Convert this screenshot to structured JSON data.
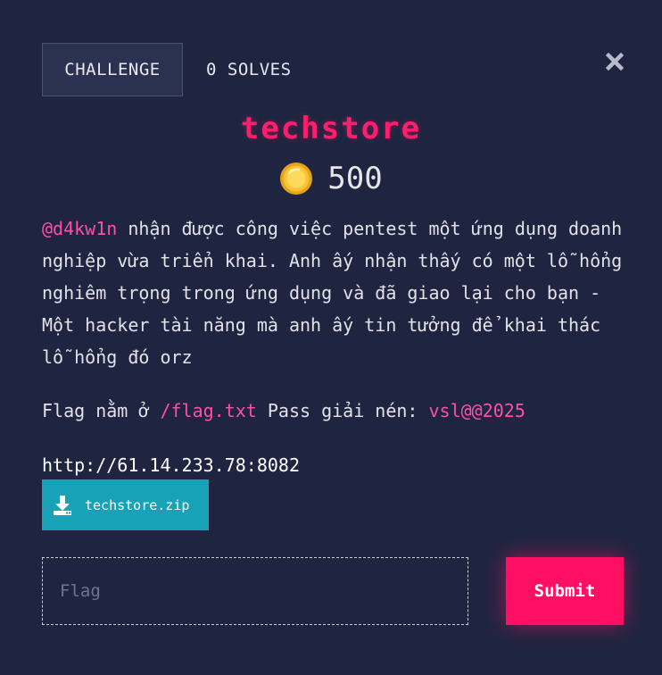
{
  "tabs": {
    "challenge_label": "CHALLENGE",
    "solves_label": "0 SOLVES"
  },
  "challenge": {
    "title": "techstore",
    "points": "500",
    "description": {
      "author": "@d4kw1n",
      "text": " nhận được công việc pentest một ứng dụng doanh nghiệp vừa triển khai. Anh ấy nhận thấy có một lỗ hổng nghiêm trọng trong ứng dụng và đã giao lại cho bạn - Một hacker tài năng mà anh ấy tin tưởng để khai thác lỗ hổng đó orz"
    },
    "flag_info": {
      "prefix": "Flag nằm ở ",
      "path": "/flag.txt",
      "middle": " Pass giải nén: ",
      "password": "vsl@@2025"
    },
    "url": "http://61.14.233.78:8082",
    "file_label": "techstore.zip"
  },
  "form": {
    "flag_placeholder": "Flag",
    "flag_value": "",
    "submit_label": "Submit"
  },
  "colors": {
    "background": "#1f2540",
    "title": "#ff1e6e",
    "highlight": "#ff4fa3",
    "download_button": "#17a2b8",
    "submit_button": "#ff0f63"
  },
  "icons": {
    "close": "close-icon",
    "coin": "coin-icon",
    "download": "download-icon"
  }
}
